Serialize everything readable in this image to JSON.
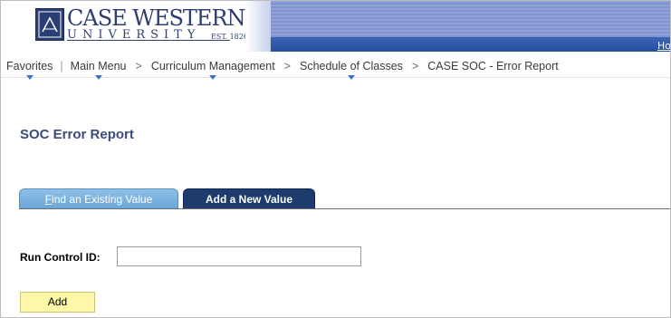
{
  "header": {
    "logo_line1": "CASE WESTERN R",
    "logo_line2": "UNIVERSITY",
    "logo_est": "EST. 1826",
    "home_link": "Ho"
  },
  "nav": {
    "items": [
      {
        "label": "Favorites"
      },
      {
        "label": "Main Menu"
      },
      {
        "label": "Curriculum Management"
      },
      {
        "label": "Schedule of Classes"
      },
      {
        "label": "CASE SOC - Error Report"
      }
    ],
    "separator": ">"
  },
  "page": {
    "title": "SOC Error Report"
  },
  "tabs": {
    "find_existing_first": "F",
    "find_existing_rest": "ind an Existing Value",
    "add_new": "Add a New Value"
  },
  "form": {
    "run_control_label": "Run Control ID:",
    "run_control_value": "",
    "add_button": "Add"
  },
  "colors": {
    "title": "#3b4b7c",
    "tab_active": "#1e3b6e",
    "tab_inactive": "#6aa6d8",
    "add_button": "#fdf7a8"
  }
}
